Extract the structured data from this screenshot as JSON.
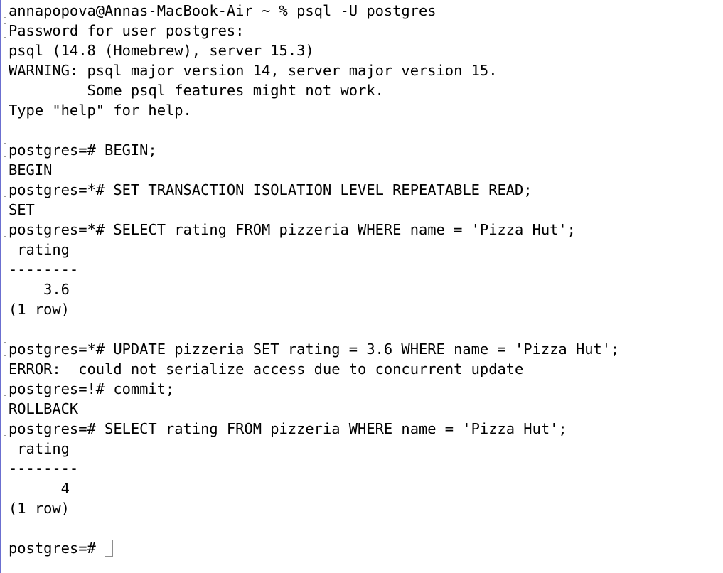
{
  "terminal": {
    "lines": [
      {
        "text": "annapopova@Annas-MacBook-Air ~ % psql -U postgres",
        "marked": true
      },
      {
        "text": "Password for user postgres:",
        "marked": true
      },
      {
        "text": "psql (14.8 (Homebrew), server 15.3)",
        "marked": false
      },
      {
        "text": "WARNING: psql major version 14, server major version 15.",
        "marked": false
      },
      {
        "text": "         Some psql features might not work.",
        "marked": false
      },
      {
        "text": "Type \"help\" for help.",
        "marked": false
      },
      {
        "text": "",
        "marked": false
      },
      {
        "text": "postgres=# BEGIN;",
        "marked": true
      },
      {
        "text": "BEGIN",
        "marked": false
      },
      {
        "text": "postgres=*# SET TRANSACTION ISOLATION LEVEL REPEATABLE READ;",
        "marked": true
      },
      {
        "text": "SET",
        "marked": false
      },
      {
        "text": "postgres=*# SELECT rating FROM pizzeria WHERE name = 'Pizza Hut';",
        "marked": true
      },
      {
        "text": " rating",
        "marked": false
      },
      {
        "text": "--------",
        "marked": false
      },
      {
        "text": "    3.6",
        "marked": false
      },
      {
        "text": "(1 row)",
        "marked": false
      },
      {
        "text": "",
        "marked": false
      },
      {
        "text": "postgres=*# UPDATE pizzeria SET rating = 3.6 WHERE name = 'Pizza Hut';",
        "marked": true
      },
      {
        "text": "ERROR:  could not serialize access due to concurrent update",
        "marked": false
      },
      {
        "text": "postgres=!# commit;",
        "marked": true
      },
      {
        "text": "ROLLBACK",
        "marked": false
      },
      {
        "text": "postgres=# SELECT rating FROM pizzeria WHERE name = 'Pizza Hut';",
        "marked": true
      },
      {
        "text": " rating",
        "marked": false
      },
      {
        "text": "--------",
        "marked": false
      },
      {
        "text": "      4",
        "marked": false
      },
      {
        "text": "(1 row)",
        "marked": false
      },
      {
        "text": "",
        "marked": false
      }
    ],
    "prompt": {
      "text": "postgres=# "
    }
  },
  "colors": {
    "background": "#ffffff",
    "text": "#000000",
    "left_border": "#6b6fd0"
  }
}
